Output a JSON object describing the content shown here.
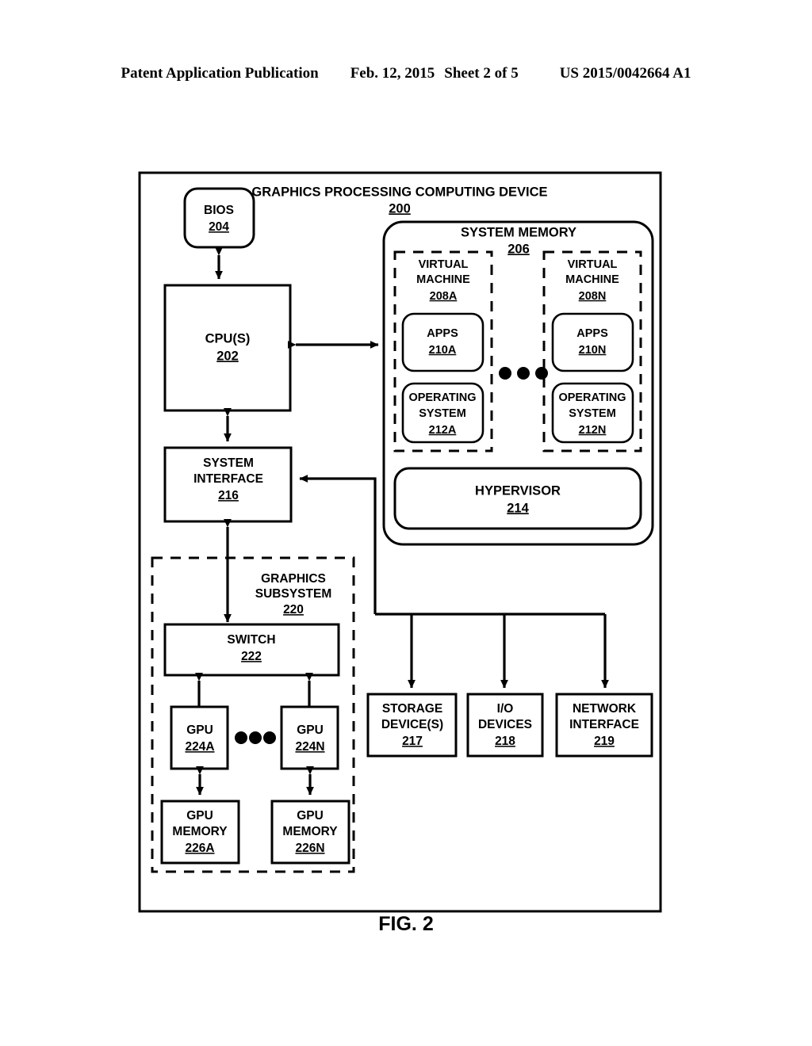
{
  "header": {
    "publication": "Patent Application Publication",
    "date": "Feb. 12, 2015",
    "sheet": "Sheet 2 of 5",
    "number": "US 2015/0042664 A1"
  },
  "figure": {
    "caption": "FIG. 2"
  },
  "diagram": {
    "outer": {
      "title": "GRAPHICS PROCESSING COMPUTING DEVICE",
      "ref": "200"
    },
    "bios": {
      "label": "BIOS",
      "ref": "204"
    },
    "cpu": {
      "label": "CPU(S)",
      "ref": "202"
    },
    "system_interface": {
      "line1": "SYSTEM",
      "line2": "INTERFACE",
      "ref": "216"
    },
    "system_memory": {
      "title": "SYSTEM MEMORY",
      "ref": "206"
    },
    "virtual_machines": [
      {
        "line1": "VIRTUAL",
        "line2": "MACHINE",
        "ref": "208A",
        "apps": {
          "label": "APPS",
          "ref": "210A"
        },
        "os": {
          "line1": "OPERATING",
          "line2": "SYSTEM",
          "ref": "212A"
        }
      },
      {
        "line1": "VIRTUAL",
        "line2": "MACHINE",
        "ref": "208N",
        "apps": {
          "label": "APPS",
          "ref": "210N"
        },
        "os": {
          "line1": "OPERATING",
          "line2": "SYSTEM",
          "ref": "212N"
        }
      }
    ],
    "hypervisor": {
      "label": "HYPERVISOR",
      "ref": "214"
    },
    "graphics_subsystem": {
      "line1": "GRAPHICS",
      "line2": "SUBSYSTEM",
      "ref": "220"
    },
    "switch": {
      "label": "SWITCH",
      "ref": "222"
    },
    "gpus": [
      {
        "label": "GPU",
        "ref": "224A"
      },
      {
        "label": "GPU",
        "ref": "224N"
      }
    ],
    "gpu_memories": [
      {
        "line1": "GPU",
        "line2": "MEMORY",
        "ref": "226A"
      },
      {
        "line1": "GPU",
        "line2": "MEMORY",
        "ref": "226N"
      }
    ],
    "peripherals": [
      {
        "line1": "STORAGE",
        "line2": "DEVICE(S)",
        "ref": "217"
      },
      {
        "line1": "I/O",
        "line2": "DEVICES",
        "ref": "218"
      },
      {
        "line1": "NETWORK",
        "line2": "INTERFACE",
        "ref": "219"
      }
    ],
    "ellipsis_glyph": "three-dots"
  }
}
